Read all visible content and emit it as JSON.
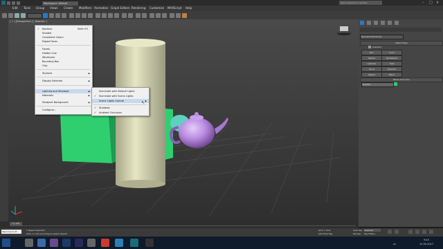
{
  "titlebar": {
    "workspace": "Workspace: Default",
    "search_placeholder": "Type a keyword or phrase"
  },
  "menubar": {
    "items": [
      "Edit",
      "Tools",
      "Group",
      "Views",
      "Create",
      "Modifiers",
      "Animation",
      "Graph Editors",
      "Rendering",
      "Customize",
      "MAXScript",
      "Help"
    ]
  },
  "viewport": {
    "label": "[ + ] [Perspective ] [ Realistic ]"
  },
  "context_menu": {
    "items": [
      {
        "label": "Realistic",
        "shortcut": "Shift+F3",
        "checked": "✓"
      },
      {
        "label": "Shaded"
      },
      {
        "label": "Consistent Colors"
      },
      {
        "label": "Edged Faces"
      },
      {
        "label": "Facets"
      },
      {
        "label": "Hidden Line"
      },
      {
        "label": "Wireframe"
      },
      {
        "label": "Bounding Box"
      },
      {
        "label": "Clay"
      },
      {
        "label": "Stylized"
      },
      {
        "label": "Display Selected"
      },
      {
        "label": "Lighting and Shadows"
      },
      {
        "label": "Materials"
      },
      {
        "label": "Viewport Background"
      },
      {
        "label": "Configure..."
      }
    ],
    "submenu": [
      {
        "label": "Illuminate with Default Lights",
        "checked": ""
      },
      {
        "label": "Illuminate with Scene Lights",
        "checked": "✓"
      },
      {
        "label": "Scene Lights Control",
        "checked": ""
      },
      {
        "label": "Shadows",
        "checked": "✓"
      },
      {
        "label": "Ambient Occlusion",
        "checked": "✓"
      }
    ]
  },
  "command_panel": {
    "dropdown": "Standard Primitives",
    "rollout_object_type": "Object Type",
    "autogrid": "AutoGrid",
    "buttons": [
      "Box",
      "Cone",
      "Sphere",
      "GeoSphere",
      "Cylinder",
      "Tube",
      "Torus",
      "Pyramid",
      "Teapot",
      "Plane"
    ],
    "rollout_name_color": "Name and Color",
    "name_field": "Box001"
  },
  "timeline": {
    "frame": "0 / 100"
  },
  "statusbar": {
    "left_text": "Welcome to M",
    "selected": "1 Object Selected",
    "prompt": "Click or click-and-drag to select objects",
    "grid": "Grid = 10.0",
    "add_time_tag": "Add Time Tag",
    "auto_key": "Auto Key",
    "selected_dropdown": "Selected",
    "set_key": "Set Key",
    "key_filters": "Key Filters..."
  },
  "taskbar": {
    "time": "9:43",
    "date": "12.03.2017",
    "lang": "RU"
  },
  "colors": {
    "teapot": "#b98be0",
    "cylinder": "#e0e0b8",
    "box": "#2fcf70",
    "accent": "#2a78c8"
  }
}
